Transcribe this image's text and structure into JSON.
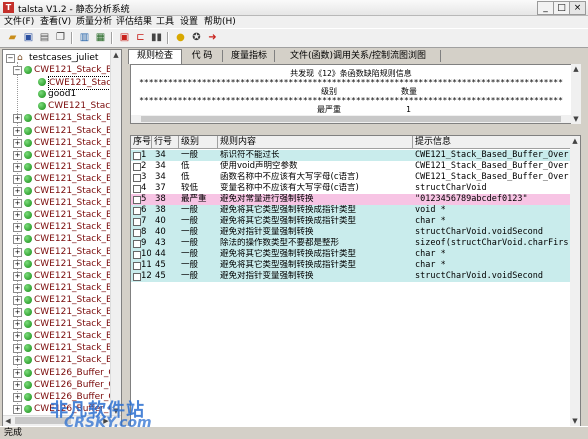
{
  "window": {
    "title": "talsta V1.2 - 静态分析系统",
    "minimize": "_",
    "maximize": "□",
    "close": "×"
  },
  "menu": [
    "文件(F)",
    "查看(V)",
    "质量分析",
    "评估结果",
    "工具",
    "设置",
    "帮助(H)"
  ],
  "toolbar_icons": [
    "open-folder-icon",
    "save-icon",
    "print-icon",
    "copy-icon",
    "chart-icon",
    "table-icon",
    "red-icon",
    "code-icon",
    "pause-icon",
    "help-icon",
    "compass-icon",
    "redo-icon"
  ],
  "tree": {
    "root": "testcases_juliet",
    "items": [
      {
        "label": "CWE121_Stack_Ba",
        "expander": "−",
        "level": 1
      },
      {
        "label": "CWE121_Stack",
        "expander": "",
        "level": 2,
        "selected": true
      },
      {
        "label": "good1",
        "expander": "",
        "level": 2,
        "dark": true
      },
      {
        "label": "CWE121_Stack",
        "expander": "",
        "level": 2
      },
      {
        "label": "CWE121_Stack_Ba",
        "expander": "+",
        "level": 1
      },
      {
        "label": "CWE121_Stack_Ba",
        "expander": "+",
        "level": 1
      },
      {
        "label": "CWE121_Stack_Ba",
        "expander": "+",
        "level": 1
      },
      {
        "label": "CWE121_Stack_Ba",
        "expander": "+",
        "level": 1
      },
      {
        "label": "CWE121_Stack_Ba",
        "expander": "+",
        "level": 1
      },
      {
        "label": "CWE121_Stack_Ba",
        "expander": "+",
        "level": 1
      },
      {
        "label": "CWE121_Stack_Ba",
        "expander": "+",
        "level": 1
      },
      {
        "label": "CWE121_Stack_Ba",
        "expander": "+",
        "level": 1
      },
      {
        "label": "CWE121_Stack_Ba",
        "expander": "+",
        "level": 1
      },
      {
        "label": "CWE121_Stack_Ba",
        "expander": "+",
        "level": 1
      },
      {
        "label": "CWE121_Stack_Ba",
        "expander": "+",
        "level": 1
      },
      {
        "label": "CWE121_Stack_Ba",
        "expander": "+",
        "level": 1
      },
      {
        "label": "CWE121_Stack_Ba",
        "expander": "+",
        "level": 1
      },
      {
        "label": "CWE121_Stack_Ba",
        "expander": "+",
        "level": 1
      },
      {
        "label": "CWE121_Stack_Ba",
        "expander": "+",
        "level": 1
      },
      {
        "label": "CWE121_Stack_Ba",
        "expander": "+",
        "level": 1
      },
      {
        "label": "CWE121_Stack_Ba",
        "expander": "+",
        "level": 1
      },
      {
        "label": "CWE121_Stack_Ba",
        "expander": "+",
        "level": 1
      },
      {
        "label": "CWE121_Stack_Ba",
        "expander": "+",
        "level": 1
      },
      {
        "label": "CWE121_Stack_Ba",
        "expander": "+",
        "level": 1
      },
      {
        "label": "CWE121_Stack_Ba",
        "expander": "+",
        "level": 1
      },
      {
        "label": "CWE126_Buffer_O",
        "expander": "+",
        "level": 1
      },
      {
        "label": "CWE126_Buffer_O",
        "expander": "+",
        "level": 1
      },
      {
        "label": "CWE126_Buffer_O",
        "expander": "+",
        "level": 1
      },
      {
        "label": "CWE126_Buffer_O",
        "expander": "+",
        "level": 1
      },
      {
        "label": "CWE126_Buffer_O",
        "expander": "+",
        "level": 1
      }
    ]
  },
  "tabs": [
    "规则检查",
    "代  码",
    "度量指标",
    "文件(函数)调用关系/控制流图浏图"
  ],
  "report": {
    "line1": "共发现《12》条函数缺陷规则信息",
    "sep": "****************************************************************************************",
    "col_level": "级别",
    "col_count": "数量",
    "row1_level": "最严重",
    "row1_count": "1"
  },
  "table": {
    "headers": [
      "序号",
      "行号",
      "级别",
      "规则内容",
      "提示信息"
    ],
    "rows": [
      {
        "no": "1",
        "line": "34",
        "level": "一般",
        "rule": "标识符不能过长",
        "hint": "CWE121_Stack_Based_Buffer_Overflow__ch...",
        "bg": "#c9ecec"
      },
      {
        "no": "2",
        "line": "34",
        "level": "低",
        "rule": "使用void声明空参数",
        "hint": "CWE121_Stack_Based_Buffer_Overflow__ch...",
        "bg": "#ffffff"
      },
      {
        "no": "3",
        "line": "34",
        "level": "低",
        "rule": "函数名称中不应该有大写字母(c语言)",
        "hint": "CWE121_Stack_Based_Buffer_Overflow__ch...",
        "bg": "#ffffff"
      },
      {
        "no": "4",
        "line": "37",
        "level": "较低",
        "rule": "变量名称中不应该有大写字母(c语言)",
        "hint": "structCharVoid",
        "bg": "#ffffff"
      },
      {
        "no": "5",
        "line": "38",
        "level": "最严重",
        "rule": "避免对常量进行强制转换",
        "hint": "\"0123456789abcdef0123\"",
        "bg": "#f7c4e4"
      },
      {
        "no": "6",
        "line": "38",
        "level": "一般",
        "rule": "避免将其它类型强制转换成指针类型",
        "hint": "void *",
        "bg": "#c9ecec"
      },
      {
        "no": "7",
        "line": "40",
        "level": "一般",
        "rule": "避免将其它类型强制转换成指针类型",
        "hint": "char *",
        "bg": "#c9ecec"
      },
      {
        "no": "8",
        "line": "40",
        "level": "一般",
        "rule": "避免对指针变量强制转换",
        "hint": "structCharVoid.voidSecond",
        "bg": "#c9ecec"
      },
      {
        "no": "9",
        "line": "43",
        "level": "一般",
        "rule": "除法的操作数类型不要都是整形",
        "hint": "sizeof(structCharVoid.charFirst)/sizes...",
        "bg": "#c9ecec"
      },
      {
        "no": "10",
        "line": "44",
        "level": "一般",
        "rule": "避免将其它类型强制转换成指针类型",
        "hint": "char *",
        "bg": "#c9ecec"
      },
      {
        "no": "11",
        "line": "45",
        "level": "一般",
        "rule": "避免将其它类型强制转换成指针类型",
        "hint": "char *",
        "bg": "#c9ecec"
      },
      {
        "no": "12",
        "line": "45",
        "level": "一般",
        "rule": "避免对指针变量强制转换",
        "hint": "structCharVoid.voidSecond",
        "bg": "#c9ecec"
      }
    ]
  },
  "status": "完成",
  "watermark": {
    "main": "非凡软件站",
    "sub": "CRSKY.com"
  }
}
